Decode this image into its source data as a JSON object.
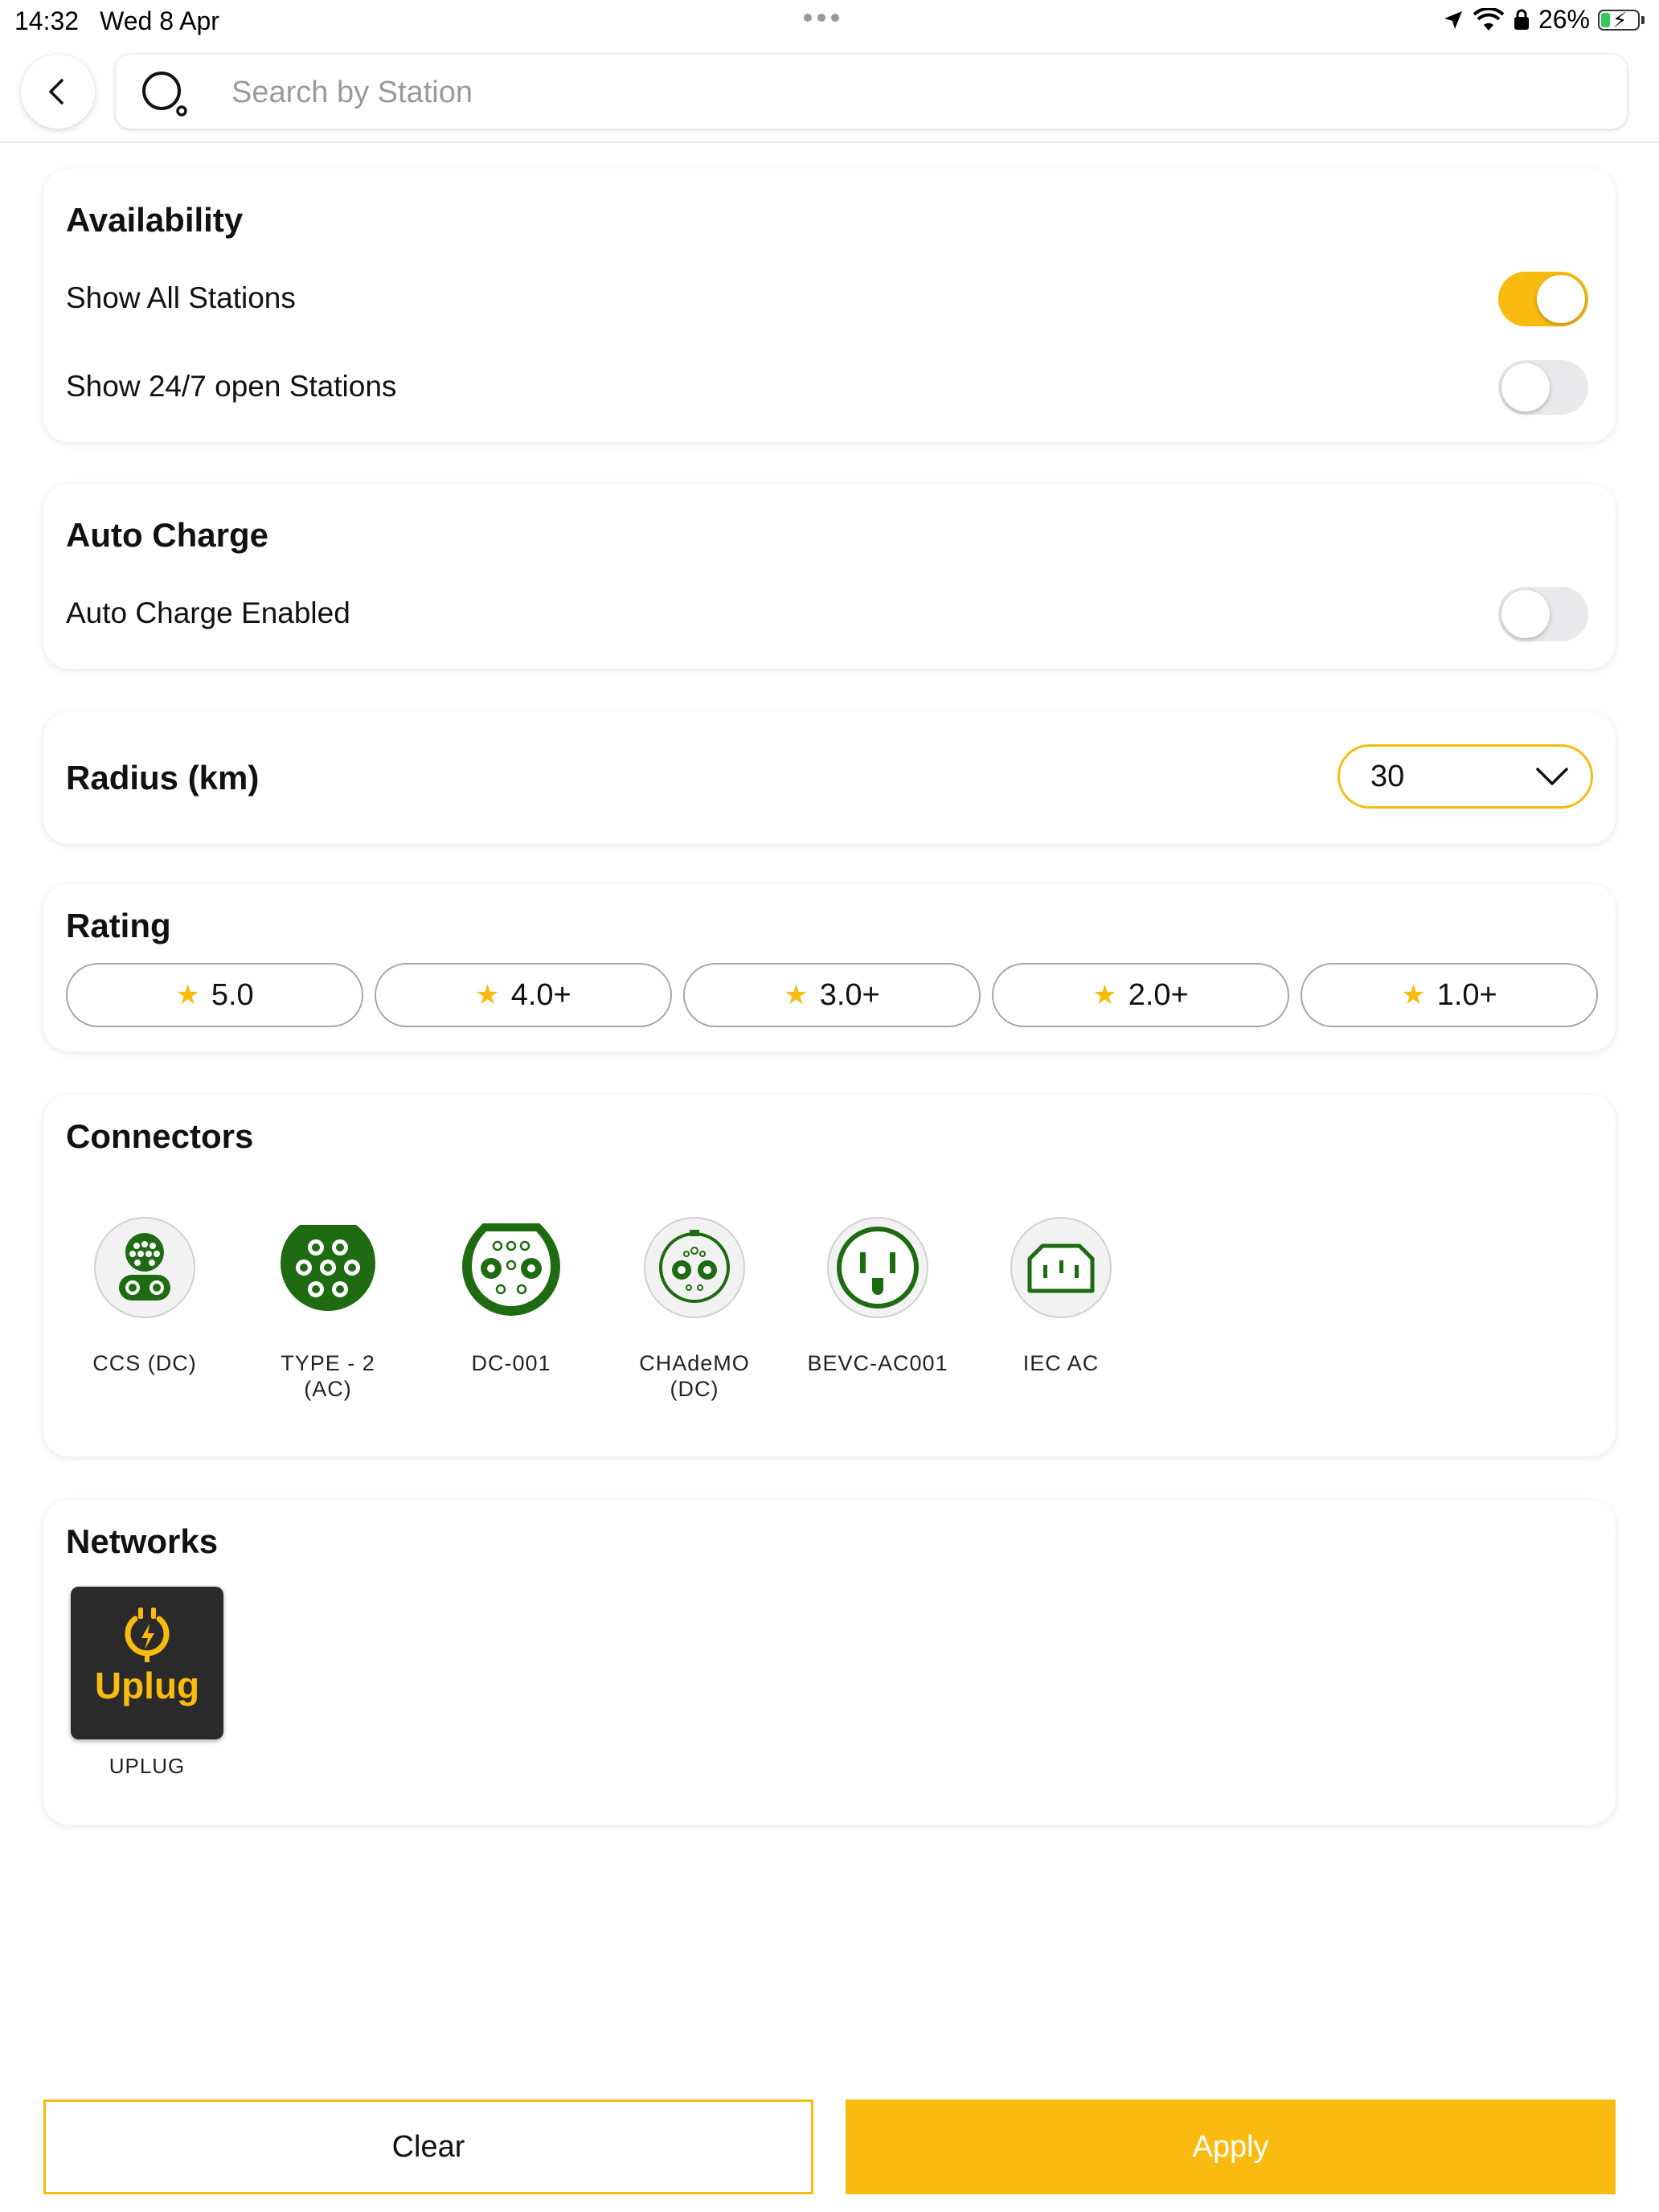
{
  "status_bar": {
    "time": "14:32",
    "date": "Wed 8 Apr",
    "battery": "26%",
    "battery_level": 0.26
  },
  "header": {
    "back_icon": "chevron-left-icon",
    "search_icon": "search-icon",
    "search_placeholder": "Search by Station",
    "search_value": ""
  },
  "availability": {
    "title": "Availability",
    "rows": [
      {
        "label": "Show All Stations",
        "on": true
      },
      {
        "label": "Show 24/7 open Stations",
        "on": false
      }
    ]
  },
  "auto_charge": {
    "title": "Auto Charge",
    "rows": [
      {
        "label": "Auto Charge Enabled",
        "on": false
      }
    ]
  },
  "radius": {
    "title": "Radius (km)",
    "selected": "30"
  },
  "rating": {
    "title": "Rating",
    "options": [
      "5.0",
      "4.0+",
      "3.0+",
      "2.0+",
      "1.0+"
    ]
  },
  "connectors": {
    "title": "Connectors",
    "items": [
      {
        "label": "CCS (DC)",
        "icon": "ccs-connector-icon"
      },
      {
        "label": "TYPE - 2\n(AC)",
        "icon": "type2-connector-icon"
      },
      {
        "label": "DC-001",
        "icon": "dc001-connector-icon"
      },
      {
        "label": "CHAdeMO\n(DC)",
        "icon": "chademo-connector-icon"
      },
      {
        "label": "BEVC-AC001",
        "icon": "bevc-connector-icon"
      },
      {
        "label": "IEC AC",
        "icon": "iec-connector-icon"
      }
    ]
  },
  "networks": {
    "title": "Networks",
    "items": [
      {
        "label": "UPLUG",
        "logo_text": "Uplug",
        "icon": "uplug-logo-icon"
      }
    ]
  },
  "actions": {
    "clear_label": "Clear",
    "apply_label": "Apply"
  },
  "colors": {
    "accent": "#f9bb10",
    "connector_green": "#1e6b12",
    "toggle_off": "#e9e9eb"
  }
}
